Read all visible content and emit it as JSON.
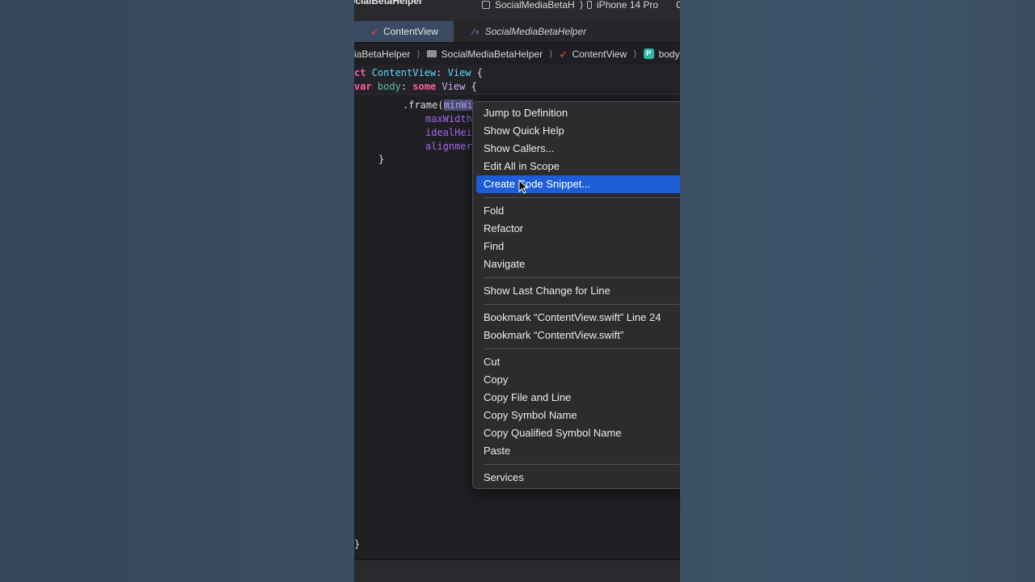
{
  "titlebar": {
    "app_name": "ocialBetaHelper",
    "scheme": "SocialMediaBetaH",
    "device": "iPhone 14 Pro",
    "trail": "C"
  },
  "tabs": [
    {
      "label": "ContentView",
      "icon": "swift-icon",
      "active": true
    },
    {
      "label": "SocialMediaBetaHelper",
      "icon": "helper-icon",
      "active": false
    }
  ],
  "jumpbar": {
    "items": [
      "iaBetaHelper",
      "SocialMediaBetaHelper",
      "ContentView",
      "body"
    ]
  },
  "code": {
    "line1_kw": "ct",
    "line1_name": "ContentView",
    "line1_colon": ":",
    "line1_type": "View",
    "line1_brace": "{",
    "line2_kw": "var",
    "line2_name": "body",
    "line2_colon": ":",
    "line2_some": "some",
    "line2_type": "View",
    "line2_brace": "{",
    "frame_prefix": ".frame(",
    "frame_selected": "minWi",
    "arg2": "maxWidth",
    "arg3": "idealHei",
    "arg4": "alignmer",
    "close_inner": "}",
    "close_outer": "}"
  },
  "context_menu": {
    "groups": [
      [
        "Jump to Definition",
        "Show Quick Help",
        "Show Callers...",
        "Edit All in Scope",
        "Create Code Snippet..."
      ],
      [
        "Fold",
        "Refactor",
        "Find",
        "Navigate"
      ],
      [
        "Show Last Change for Line"
      ],
      [
        "Bookmark “ContentView.swift” Line 24",
        "Bookmark “ContentView.swift”"
      ],
      [
        "Cut",
        "Copy",
        "Copy File and Line",
        "Copy Symbol Name",
        "Copy Qualified Symbol Name",
        "Paste"
      ],
      [
        "Services"
      ]
    ],
    "highlighted": "Create Code Snippet..."
  }
}
